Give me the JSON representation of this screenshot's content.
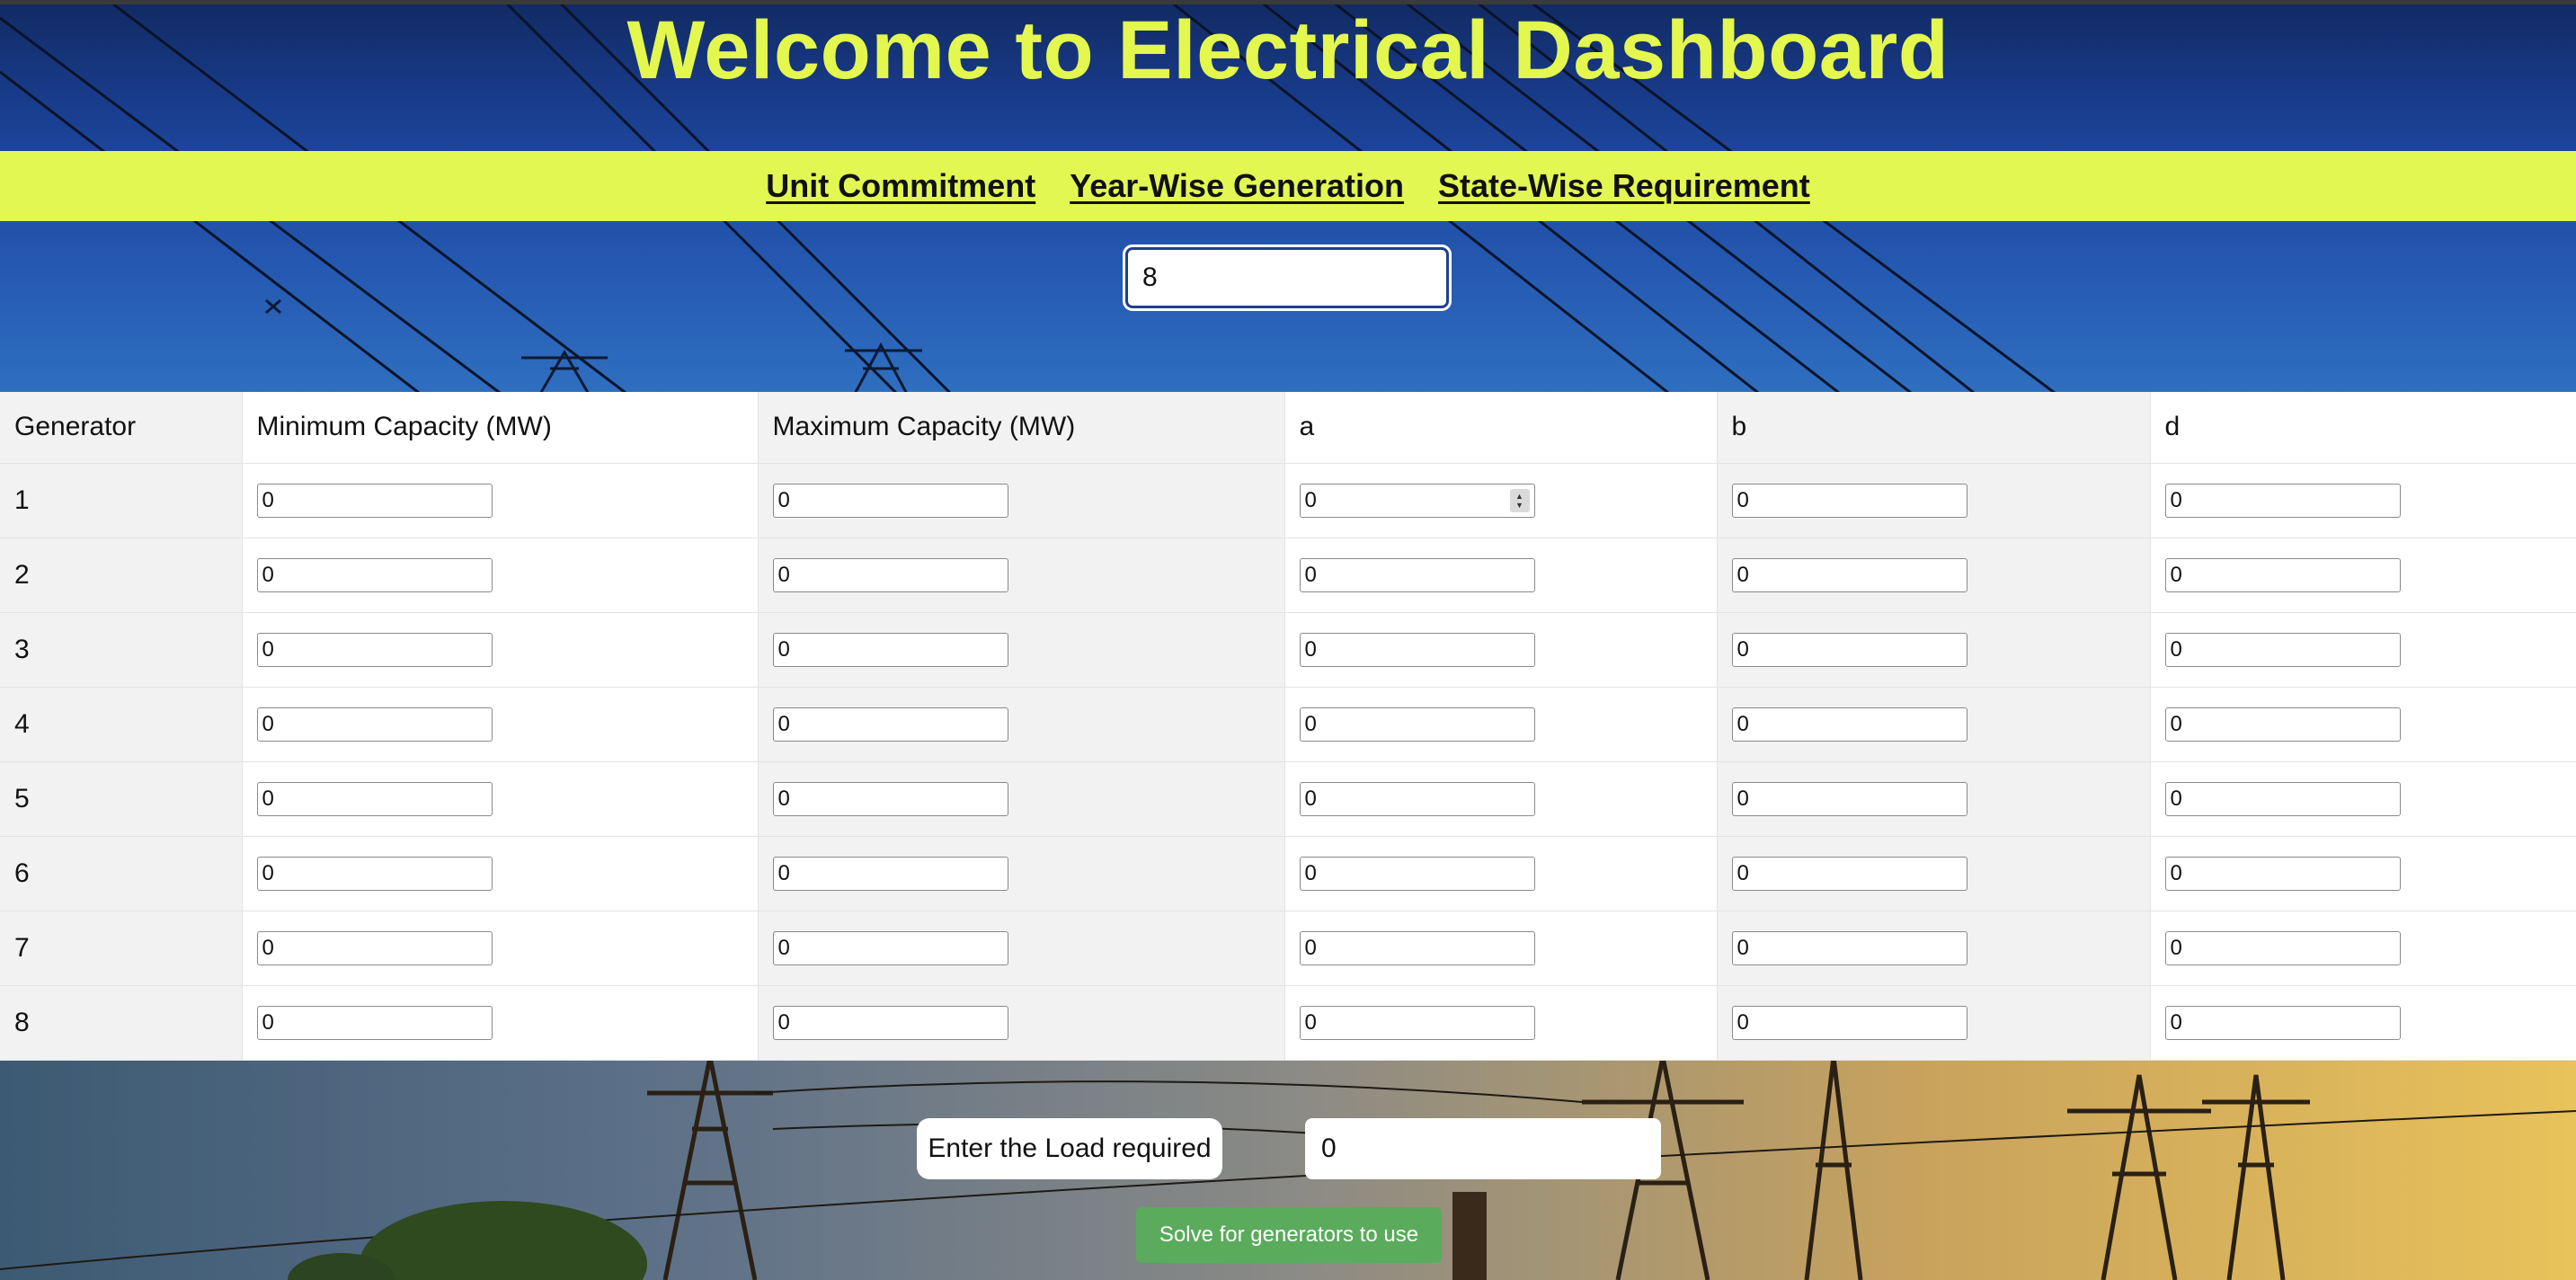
{
  "header": {
    "title": "Welcome to Electrical Dashboard"
  },
  "nav": {
    "items": [
      "Unit Commitment",
      "Year-Wise Generation",
      "State-Wise Requirement"
    ]
  },
  "generator_count": {
    "value": "8"
  },
  "table": {
    "columns": [
      "Generator",
      "Minimum Capacity (MW)",
      "Maximum Capacity (MW)",
      "a",
      "b",
      "d"
    ],
    "rows": [
      {
        "generator": "1",
        "min": "0",
        "max": "0",
        "a": "0",
        "b": "0",
        "d": "0"
      },
      {
        "generator": "2",
        "min": "0",
        "max": "0",
        "a": "0",
        "b": "0",
        "d": "0"
      },
      {
        "generator": "3",
        "min": "0",
        "max": "0",
        "a": "0",
        "b": "0",
        "d": "0"
      },
      {
        "generator": "4",
        "min": "0",
        "max": "0",
        "a": "0",
        "b": "0",
        "d": "0"
      },
      {
        "generator": "5",
        "min": "0",
        "max": "0",
        "a": "0",
        "b": "0",
        "d": "0"
      },
      {
        "generator": "6",
        "min": "0",
        "max": "0",
        "a": "0",
        "b": "0",
        "d": "0"
      },
      {
        "generator": "7",
        "min": "0",
        "max": "0",
        "a": "0",
        "b": "0",
        "d": "0"
      },
      {
        "generator": "8",
        "min": "0",
        "max": "0",
        "a": "0",
        "b": "0",
        "d": "0"
      }
    ]
  },
  "load": {
    "label": "Enter the Load required",
    "value": "0"
  },
  "solve": {
    "label": "Solve for generators to use"
  },
  "icons": {
    "stepper": "number-stepper-icon"
  },
  "colors": {
    "accent": "#e4f74e",
    "nav_bar": "#e2f752",
    "solve_button": "#5aab5c",
    "sky_top": "#112a63"
  }
}
